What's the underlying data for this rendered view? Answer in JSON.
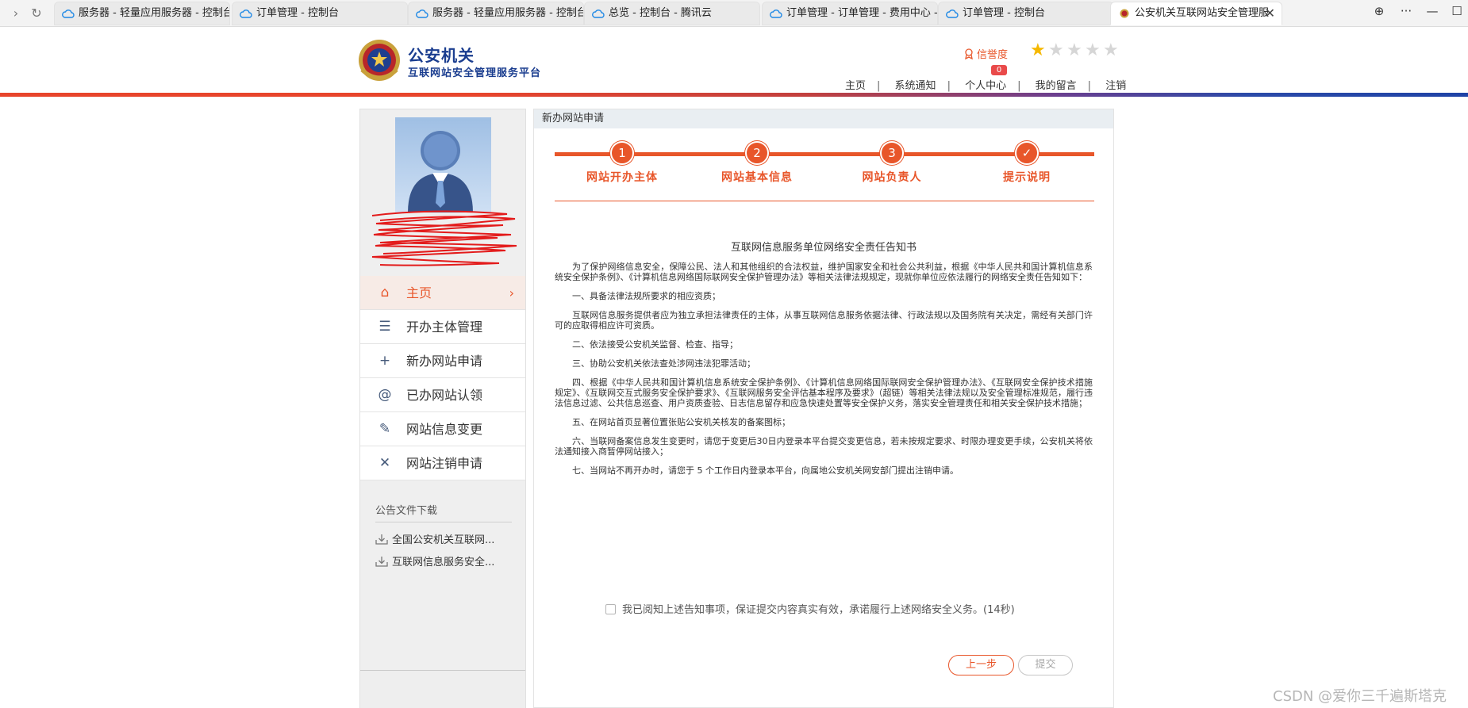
{
  "browser": {
    "tabs": [
      {
        "title": "服务器 - 轻量应用服务器 - 控制台",
        "active": false
      },
      {
        "title": "订单管理 - 控制台",
        "active": false
      },
      {
        "title": "服务器 - 轻量应用服务器 - 控制台",
        "active": false
      },
      {
        "title": "总览 - 控制台 - 腾讯云",
        "active": false
      },
      {
        "title": "订单管理 - 订单管理 - 费用中心 - ",
        "active": false
      },
      {
        "title": "订单管理 - 控制台",
        "active": false
      },
      {
        "title": "公安机关互联网站安全管理服",
        "active": true
      }
    ],
    "close_glyph": "✕",
    "window_buttons": [
      "⊕",
      "···",
      "—",
      "☐"
    ]
  },
  "header": {
    "brand_title": "公安机关",
    "brand_subtitle": "互联网站安全管理服务平台",
    "credit_label": "信誉度",
    "stars_total": 5,
    "stars_filled": 1,
    "nav": [
      "主页",
      "系统通知",
      "个人中心",
      "我的留言",
      "注销"
    ],
    "message_badge": "0",
    "colors": {
      "accent": "#e8562a",
      "brand": "#1a3d8f"
    }
  },
  "sidebar": {
    "menu": [
      {
        "label": "主页",
        "icon": "home-icon",
        "glyph": "⌂",
        "active": true
      },
      {
        "label": "开办主体管理",
        "icon": "list-icon",
        "glyph": "☰",
        "active": false
      },
      {
        "label": "新办网站申请",
        "icon": "plus-icon",
        "glyph": "+",
        "active": false
      },
      {
        "label": "已办网站认领",
        "icon": "at-icon",
        "glyph": "@",
        "active": false
      },
      {
        "label": "网站信息变更",
        "icon": "edit-icon",
        "glyph": "✎",
        "active": false
      },
      {
        "label": "网站注销申请",
        "icon": "close-icon",
        "glyph": "✕",
        "active": false
      }
    ],
    "downloads_title": "公告文件下载",
    "downloads": [
      "全国公安机关互联网...",
      "互联网信息服务安全..."
    ]
  },
  "main": {
    "panel_title": "新办网站申请",
    "steps": [
      {
        "num": "1",
        "label": "网站开办主体"
      },
      {
        "num": "2",
        "label": "网站基本信息"
      },
      {
        "num": "3",
        "label": "网站负责人"
      },
      {
        "num": "✓",
        "label": "提示说明"
      }
    ],
    "notice_title": "互联网信息服务单位网络安全责任告知书",
    "notice_paragraphs": [
      "为了保护网络信息安全，保障公民、法人和其他组织的合法权益，维护国家安全和社会公共利益，根据《中华人民共和国计算机信息系统安全保护条例》、《计算机信息网络国际联网安全保护管理办法》等相关法律法规规定，现就你单位应依法履行的网络安全责任告知如下：",
      "一、具备法律法规所要求的相应资质；",
      "互联网信息服务提供者应为独立承担法律责任的主体，从事互联网信息服务依据法律、行政法规以及国务院有关决定，需经有关部门许可的应取得相应许可资质。",
      "二、依法接受公安机关监督、检查、指导；",
      "三、协助公安机关依法查处涉网违法犯罪活动；",
      "四、根据《中华人民共和国计算机信息系统安全保护条例》、《计算机信息网络国际联网安全保护管理办法》、《互联网安全保护技术措施规定》、《互联网交互式服务安全保护要求》、《互联网服务安全评估基本程序及要求》（超链）等相关法律法规以及安全管理标准规范，履行违法信息过滤、公共信息巡查、用户资质查验、日志信息留存和应急快速处置等安全保护义务，落实安全管理责任和相关安全保护技术措施；",
      "五、在网站首页显著位置张贴公安机关核发的备案图标；",
      "六、当联网备案信息发生变更时，请您于变更后30日内登录本平台提交变更信息，若未按规定要求、时限办理变更手续，公安机关将依法通知接入商暂停网站接入；",
      "七、当网站不再开办时，请您于 5 个工作日内登录本平台，向属地公安机关网安部门提出注销申请。"
    ],
    "agree_text": "我已阅知上述告知事项，保证提交内容真实有效，承诺履行上述网络安全义务。(14秒)",
    "prev_button": "上一步",
    "submit_button": "提交"
  },
  "watermark": "CSDN @爱你三千遍斯塔克"
}
